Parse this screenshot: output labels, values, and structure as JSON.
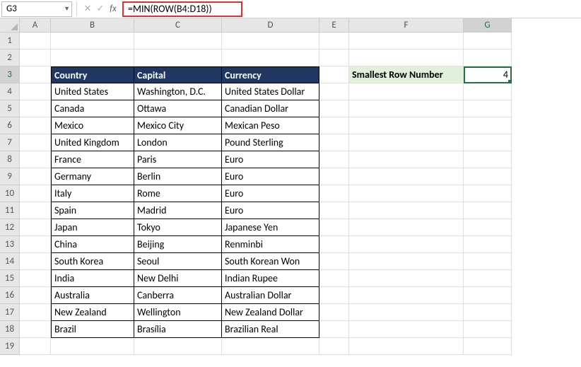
{
  "nameBox": "G3",
  "formula": "=MIN(ROW(B4:D18))",
  "columns": [
    "A",
    "B",
    "C",
    "D",
    "E",
    "F",
    "G"
  ],
  "rowCount": 19,
  "activeCol": "G",
  "activeRow": 3,
  "headers": {
    "country": "Country",
    "capital": "Capital",
    "currency": "Currency"
  },
  "label": "Smallest Row Number",
  "result": "4",
  "table": [
    {
      "country": "United States",
      "capital": "Washington, D.C.",
      "currency": "United States Dollar"
    },
    {
      "country": "Canada",
      "capital": "Ottawa",
      "currency": "Canadian Dollar"
    },
    {
      "country": "Mexico",
      "capital": "Mexico City",
      "currency": "Mexican Peso"
    },
    {
      "country": "United Kingdom",
      "capital": "London",
      "currency": "Pound Sterling"
    },
    {
      "country": "France",
      "capital": "Paris",
      "currency": "Euro"
    },
    {
      "country": "Germany",
      "capital": "Berlin",
      "currency": "Euro"
    },
    {
      "country": "Italy",
      "capital": "Rome",
      "currency": "Euro"
    },
    {
      "country": "Spain",
      "capital": "Madrid",
      "currency": "Euro"
    },
    {
      "country": "Japan",
      "capital": "Tokyo",
      "currency": "Japanese Yen"
    },
    {
      "country": "China",
      "capital": "Beijing",
      "currency": "Renminbi"
    },
    {
      "country": "South Korea",
      "capital": "Seoul",
      "currency": "South Korean Won"
    },
    {
      "country": "India",
      "capital": "New Delhi",
      "currency": "Indian Rupee"
    },
    {
      "country": "Australia",
      "capital": "Canberra",
      "currency": "Australian Dollar"
    },
    {
      "country": "New Zealand",
      "capital": "Wellington",
      "currency": "New Zealand Dollar"
    },
    {
      "country": "Brazil",
      "capital": "Brasília",
      "currency": "Brazilian Real"
    }
  ]
}
